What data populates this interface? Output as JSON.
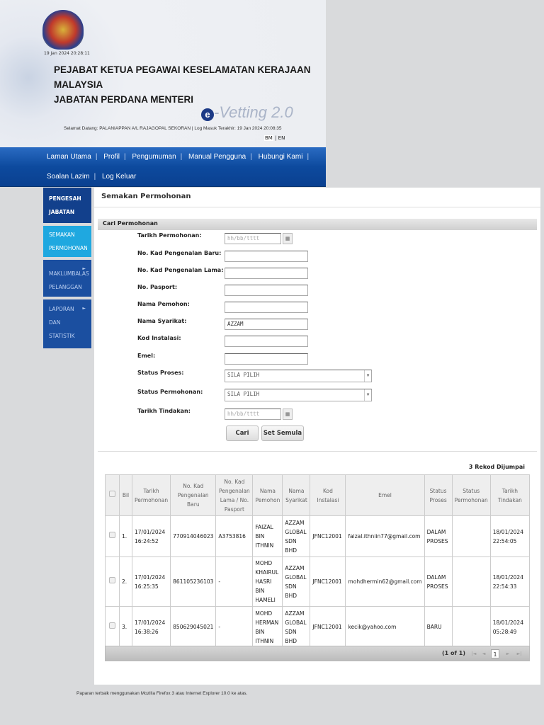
{
  "header": {
    "timestamp": "19 Jan 2024 20:28:11",
    "org_line1": "PEJABAT KETUA PEGAWAI KESELAMATAN KERAJAAN",
    "org_line2": "MALAYSIA",
    "org_line3": "JABATAN PERDANA MENTERI",
    "logo_e": "e",
    "logo_text": "-Vetting 2.0",
    "welcome": "Selamat Datang: PALANIAPPAN A/L RAJAGOPAL SEKORAN | Log Masuk Terakhir: 19 Jan 2024 20:08:35",
    "lang_bm": "BM",
    "lang_sep": "|",
    "lang_en": "EN"
  },
  "nav": {
    "sep": "|",
    "items": [
      "Laman Utama",
      "Profil",
      "Pengumuman",
      "Manual Pengguna",
      "Hubungi Kami",
      "Soalan Lazim",
      "Log Keluar"
    ]
  },
  "sidebar": {
    "header": "PENGESAH JABATAN",
    "items": [
      "SEMAKAN PERMOHONAN",
      "MAKLUMBALAS PELANGGAN",
      "LAPORAN DAN STATISTIK"
    ],
    "arrow": "►"
  },
  "main": {
    "title": "Semakan Permohonan",
    "section": "Cari Permohonan",
    "fields": {
      "tarikh_permohonan": "Tarikh Permohonan:",
      "kp_baru": "No. Kad Pengenalan Baru:",
      "kp_lama": "No. Kad Pengenalan Lama:",
      "pasport": "No. Pasport:",
      "nama": "Nama Pemohon:",
      "syarikat": "Nama Syarikat:",
      "kod": "Kod Instalasi:",
      "emel": "Emel:",
      "status_proses": "Status Proses:",
      "status_permohonan": "Status Permohonan:",
      "tarikh_tindakan": "Tarikh Tindakan:"
    },
    "values": {
      "date_placeholder": "hh/bb/tttt",
      "syarikat": "AZZAM",
      "status_proses": "SILA PILIH",
      "status_permohonan": "SILA PILIH"
    },
    "buttons": {
      "cari": "Cari",
      "reset": "Set Semula"
    },
    "count": "3 Rekod Dijumpai",
    "columns": [
      "Bil",
      "Tarikh Permohonan",
      "No. Kad Pengenalan Baru",
      "No. Kad Pengenalan Lama / No. Pasport",
      "Nama Pemohon",
      "Nama Syarikat",
      "Kod Instalasi",
      "Emel",
      "Status Proses",
      "Status Permohonan",
      "Tarikh Tindakan"
    ],
    "rows": [
      [
        "1.",
        "17/01/2024 16:24:52",
        "770914046023",
        "A3753816",
        "FAIZAL BIN ITHNIN",
        "AZZAM GLOBAL SDN BHD",
        "JFNC12001",
        "faizal.ithniin77@gmail.com",
        "DALAM PROSES",
        "",
        "18/01/2024 22:54:05"
      ],
      [
        "2.",
        "17/01/2024 16:25:35",
        "861105236103",
        "-",
        "MOHD KHAIRUL HASRI BIN HAMELI",
        "AZZAM GLOBAL SDN BHD",
        "JFNC12001",
        "mohdhermin62@gmail.com",
        "DALAM PROSES",
        "",
        "18/01/2024 22:54:33"
      ],
      [
        "3.",
        "17/01/2024 16:38:26",
        "850629045021",
        "-",
        "MOHD HERMAN BIN ITHNIN",
        "AZZAM GLOBAL SDN BHD",
        "JFNC12001",
        "kecik@yahoo.com",
        "BARU",
        "",
        "18/01/2024 05:28:49"
      ]
    ],
    "pager": {
      "info": "(1 of 1)",
      "page": "1"
    }
  },
  "footer": "Paparan terbaik menggunakan Mozilla Firefox 3 atau Internet Explorer 10.0 ke atas."
}
